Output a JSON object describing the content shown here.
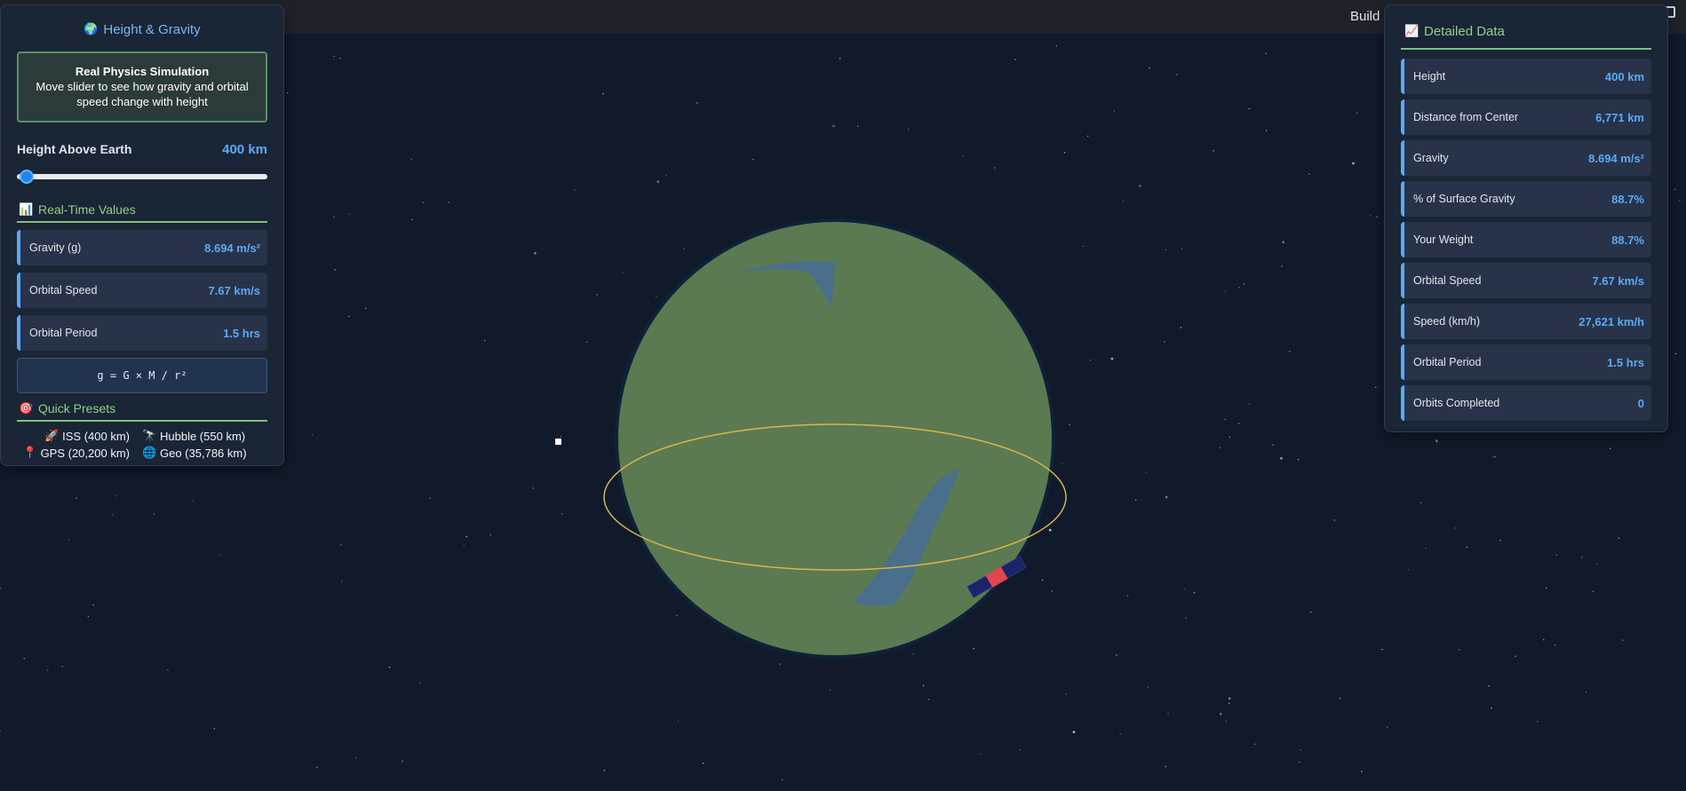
{
  "topbar": {
    "build_label": "Build"
  },
  "left_panel": {
    "title": "Height & Gravity",
    "title_icon": "globe-icon",
    "info_title": "Real Physics Simulation",
    "info_text": "Move slider to see how gravity and orbital speed change with height",
    "height_label": "Height Above Earth",
    "height_value": "400 km",
    "slider_fraction": 0.011,
    "realtime_title": "Real-Time Values",
    "realtime": [
      {
        "label": "Gravity (g)",
        "value": "8.694 m/s²"
      },
      {
        "label": "Orbital Speed",
        "value": "7.67 km/s"
      },
      {
        "label": "Orbital Period",
        "value": "1.5 hrs"
      }
    ],
    "formula": "g = G × M / r²",
    "presets_title": "Quick Presets",
    "presets": [
      {
        "icon": "🚀",
        "label": "ISS (400 km)"
      },
      {
        "icon": "🔭",
        "label": "Hubble (550 km)"
      },
      {
        "icon": "📍",
        "label": "GPS (20,200 km)"
      },
      {
        "icon": "🌐",
        "label": "Geo (35,786 km)"
      }
    ]
  },
  "right_panel": {
    "title": "Detailed Data",
    "rows": [
      {
        "label": "Height",
        "value": "400 km"
      },
      {
        "label": "Distance from Center",
        "value": "6,771 km"
      },
      {
        "label": "Gravity",
        "value": "8.694 m/s²"
      },
      {
        "label": "% of Surface Gravity",
        "value": "88.7%"
      },
      {
        "label": "Your Weight",
        "value": "88.7%"
      },
      {
        "label": "Orbital Speed",
        "value": "7.67 km/s"
      },
      {
        "label": "Speed (km/h)",
        "value": "27,621 km/h"
      },
      {
        "label": "Orbital Period",
        "value": "1.5 hrs"
      },
      {
        "label": "Orbits Completed",
        "value": "0"
      }
    ]
  },
  "colors": {
    "background": "#111a2b",
    "planet": "#5b7a51",
    "orbit": "#d8b54a",
    "accent_blue": "#5aaaf5",
    "accent_green": "#8fd08a"
  }
}
